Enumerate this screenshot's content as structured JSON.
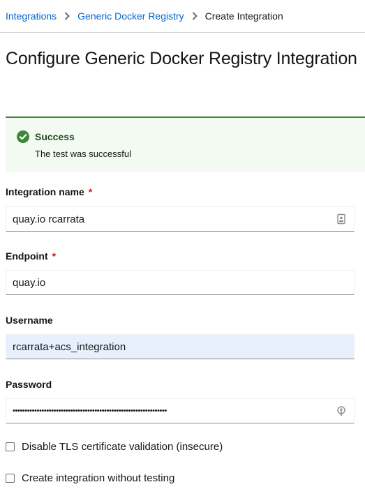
{
  "breadcrumb": {
    "items": [
      {
        "label": "Integrations"
      },
      {
        "label": "Generic Docker Registry"
      },
      {
        "label": "Create Integration"
      }
    ]
  },
  "page": {
    "title": "Configure Generic Docker Registry Integration"
  },
  "alert": {
    "title": "Success",
    "description": "The test was successful",
    "color": "#3e8635"
  },
  "form": {
    "integration_name": {
      "label": "Integration name",
      "required_marker": "*",
      "value": "quay.io rcarrata"
    },
    "endpoint": {
      "label": "Endpoint",
      "required_marker": "*",
      "value": "quay.io"
    },
    "username": {
      "label": "Username",
      "value": "rcarrata+acs_integration"
    },
    "password": {
      "label": "Password",
      "value": "••••••••••••••••••••••••••••••••••••••••••••••••••••••••••••••••"
    },
    "disable_tls": {
      "label": "Disable TLS certificate validation (insecure)",
      "checked": false
    },
    "skip_test": {
      "label": "Create integration without testing",
      "checked": false
    }
  },
  "icons": {
    "breadcrumb_separator": "chevron-right-icon",
    "alert": "check-circle-icon",
    "name_field": "password-manager-icon",
    "password_field": "password-manager-key-icon"
  }
}
